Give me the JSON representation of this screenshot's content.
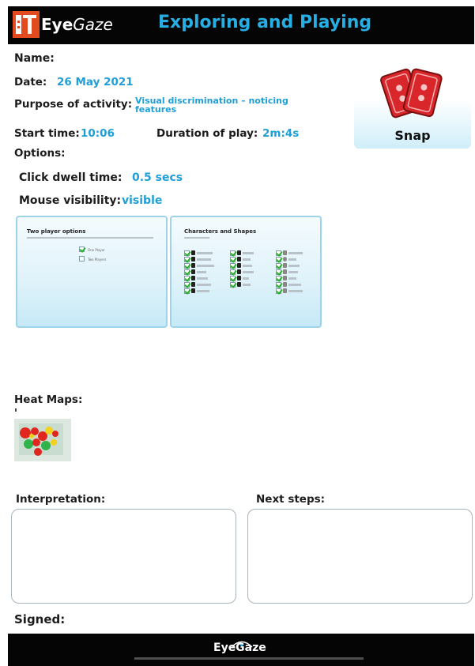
{
  "header": {
    "logo_text": "Eye",
    "logo_text_2": "Gaze",
    "title": "Exploring and Playing"
  },
  "form": {
    "name_label": "Name:",
    "date_label": "Date:",
    "date_value": "26 May 2021",
    "purpose_label": "Purpose of activity:",
    "purpose_value": "Visual discrimination – noticing features",
    "start_label": "Start time:",
    "start_value": "10:06",
    "duration_label": "Duration of play:",
    "duration_value": "2m:4s",
    "options_label": "Options:",
    "dwell_label": "Click dwell time:",
    "dwell_value": "0.5 secs",
    "mouse_label": "Mouse visibility:",
    "mouse_value": "visible"
  },
  "activity": {
    "name": "Snap"
  },
  "thumbnails": {
    "left_title": "Two player options",
    "left_option_1": "One Player",
    "left_option_2": "Two Players",
    "right_title": "Characters and Shapes"
  },
  "heatmaps": {
    "label": "Heat Maps:"
  },
  "sections": {
    "interpretation_label": "Interpretation:",
    "next_steps_label": "Next steps:",
    "signed_label": "Signed:"
  },
  "footer": {
    "logo_text": "EyeGaze"
  },
  "colors": {
    "accent": "#1f9fd8",
    "header_bg": "#050505",
    "logo_red": "#e24b20",
    "card_red": "#d9262b"
  }
}
